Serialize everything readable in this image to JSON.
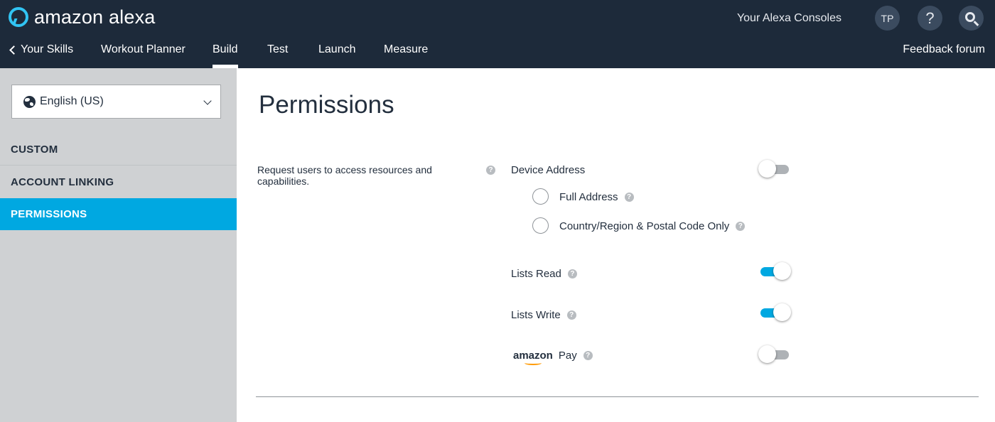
{
  "header": {
    "brand": "amazon alexa",
    "consoles_label": "Your Alexa Consoles",
    "avatar_initials": "TP",
    "help_label": "?",
    "icons": [
      "alexa-logo-icon",
      "help-icon",
      "search-icon"
    ]
  },
  "nav": {
    "back_label": "Your Skills",
    "skill_name": "Workout Planner",
    "tabs": [
      {
        "label": "Build",
        "active": true
      },
      {
        "label": "Test",
        "active": false
      },
      {
        "label": "Launch",
        "active": false
      },
      {
        "label": "Measure",
        "active": false
      }
    ],
    "feedback_label": "Feedback forum"
  },
  "sidebar": {
    "locale": "English (US)",
    "items": [
      {
        "label": "CUSTOM",
        "active": false
      },
      {
        "label": "ACCOUNT LINKING",
        "active": false
      },
      {
        "label": "PERMISSIONS",
        "active": true
      }
    ]
  },
  "main": {
    "title": "Permissions",
    "description": "Request users to access resources and capabilities.",
    "permissions": {
      "device_address": {
        "label": "Device Address",
        "enabled": false
      },
      "full_address": {
        "label": "Full Address",
        "selected": false
      },
      "postal_code": {
        "label": "Country/Region & Postal Code Only",
        "selected": false
      },
      "lists_read": {
        "label": "Lists Read",
        "enabled": true
      },
      "lists_write": {
        "label": "Lists Write",
        "enabled": true
      },
      "amazon_pay": {
        "brand": "amazon",
        "label": "Pay",
        "enabled": false
      }
    }
  },
  "colors": {
    "header_bg": "#1d2a3a",
    "accent": "#00a8e1",
    "sidebar_bg": "#cfd1d3",
    "amazon_orange": "#ff9900"
  }
}
